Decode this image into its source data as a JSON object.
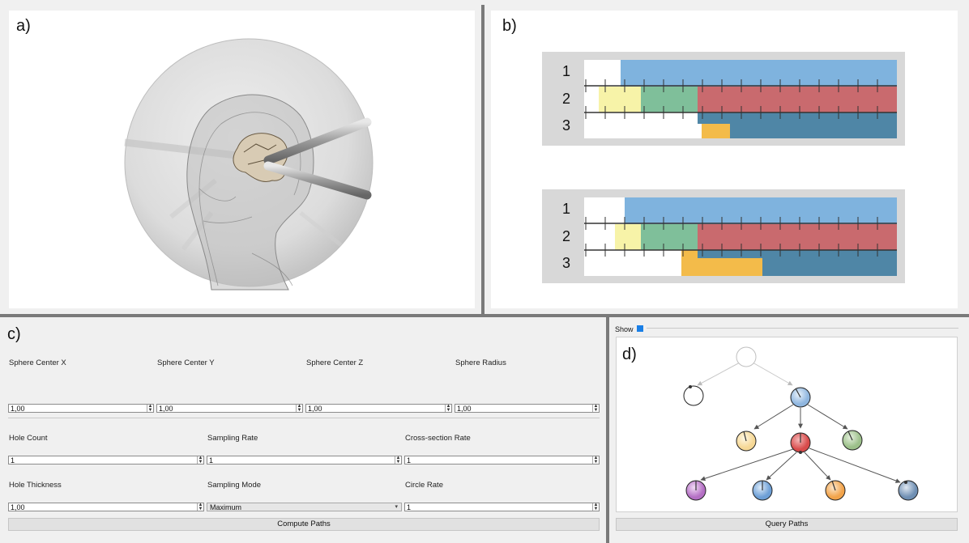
{
  "panels": {
    "a": {
      "letter": "a)"
    },
    "b": {
      "letter": "b)",
      "row_labels": [
        "1",
        "2",
        "3"
      ]
    },
    "c": {
      "letter": "c)"
    },
    "d": {
      "letter": "d)"
    }
  },
  "form": {
    "sphere_center_x": {
      "label": "Sphere Center X",
      "value": "1,00"
    },
    "sphere_center_y": {
      "label": "Sphere Center Y",
      "value": "1,00"
    },
    "sphere_center_z": {
      "label": "Sphere Center Z",
      "value": "1,00"
    },
    "sphere_radius": {
      "label": "Sphere Radius",
      "value": "1,00"
    },
    "hole_count": {
      "label": "Hole Count",
      "value": "1"
    },
    "sampling_rate": {
      "label": "Sampling Rate",
      "value": "1"
    },
    "cross_section_rate": {
      "label": "Cross-section Rate",
      "value": "1"
    },
    "hole_thickness": {
      "label": "Hole Thickness",
      "value": "1,00"
    },
    "sampling_mode": {
      "label": "Sampling Mode",
      "value": "Maximum"
    },
    "circle_rate": {
      "label": "Circle Rate",
      "value": "1"
    },
    "compute_button": "Compute Paths"
  },
  "tree": {
    "show_label": "Show",
    "show_checked": true,
    "query_button": "Query Paths",
    "node_colors": {
      "root": "#ffffff",
      "left": "#ffffff",
      "blue": "#8fb6df",
      "yellow": "#f6d896",
      "red": "#d84b4b",
      "green": "#9cc08a",
      "purple": "#b46fc4",
      "blue2": "#6d9fd6",
      "orange": "#f2a34a",
      "steel": "#6f8fb3"
    }
  },
  "colors": {
    "accent": "#1a7fe6",
    "band_blue": "#7fb3de",
    "band_red": "#c96a6e",
    "band_green": "#7fbf9a",
    "band_yellow": "#f7f3a8",
    "band_orange": "#f3bb4a",
    "band_steel": "#4f86a6",
    "divider": "#7a7a7a"
  }
}
